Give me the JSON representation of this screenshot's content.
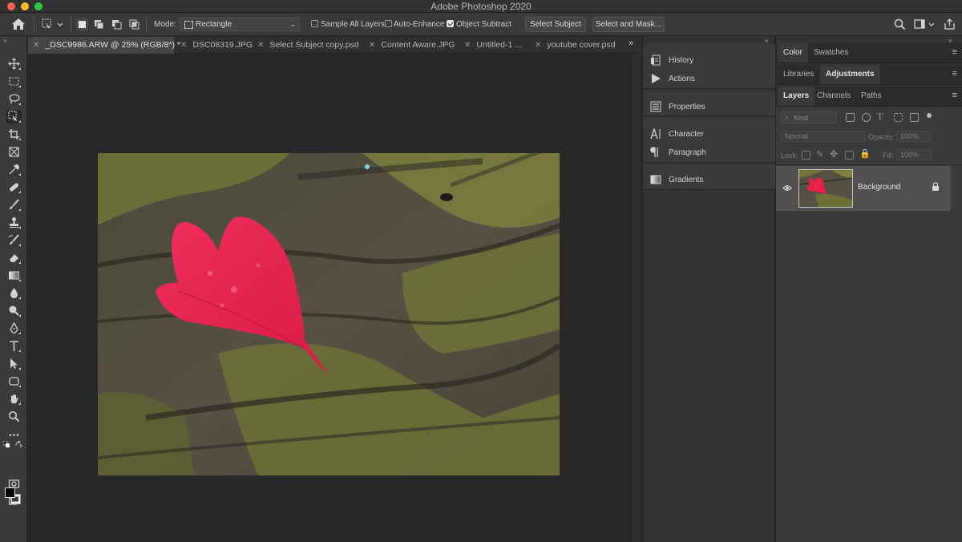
{
  "window": {
    "title": "Adobe Photoshop 2020"
  },
  "options_bar": {
    "mode_label": "Mode:",
    "mode_value": "Rectangle",
    "sample_all_layers": {
      "label": "Sample All Layers",
      "checked": false
    },
    "auto_enhance": {
      "label": "Auto-Enhance",
      "checked": false
    },
    "object_subtract": {
      "label": "Object Subtract",
      "checked": true
    },
    "select_subject": "Select Subject",
    "select_and_mask": "Select and Mask..."
  },
  "tabs": [
    {
      "label": "_DSC9986.ARW @ 25% (RGB/8*) *",
      "active": true
    },
    {
      "label": "DSC08319.JPG",
      "active": false
    },
    {
      "label": "Select Subject copy.psd",
      "active": false
    },
    {
      "label": "Content Aware.JPG",
      "active": false
    },
    {
      "label": "Untitled-1 ...",
      "active": false
    },
    {
      "label": "youtube cover.psd",
      "active": false
    }
  ],
  "middle_panels": [
    {
      "label": "History",
      "icon": "history-icon"
    },
    {
      "label": "Actions",
      "icon": "play-icon"
    },
    {
      "label": "Properties",
      "icon": "properties-icon"
    },
    {
      "label": "Character",
      "icon": "character-icon"
    },
    {
      "label": "Paragraph",
      "icon": "paragraph-icon"
    },
    {
      "label": "Gradients",
      "icon": "gradient-icon"
    }
  ],
  "right_panels": {
    "row1": [
      "Color",
      "Swatches"
    ],
    "row1_active": "Color",
    "row2": [
      "Libraries",
      "Adjustments"
    ],
    "row2_active": "Adjustments",
    "row3": [
      "Layers",
      "Channels",
      "Paths"
    ],
    "row3_active": "Layers"
  },
  "layers_panel": {
    "kind_placeholder": "Kind",
    "blend_mode": "Normal",
    "opacity_label": "Opacity:",
    "opacity_value": "100%",
    "lock_label": "Lock:",
    "fill_label": "Fill:",
    "fill_value": "100%",
    "layers": [
      {
        "name": "Background",
        "visible": true,
        "locked": true
      }
    ]
  },
  "colors": {
    "foreground": "#000000",
    "background": "#ffffff",
    "leaf": "#e8204a"
  }
}
